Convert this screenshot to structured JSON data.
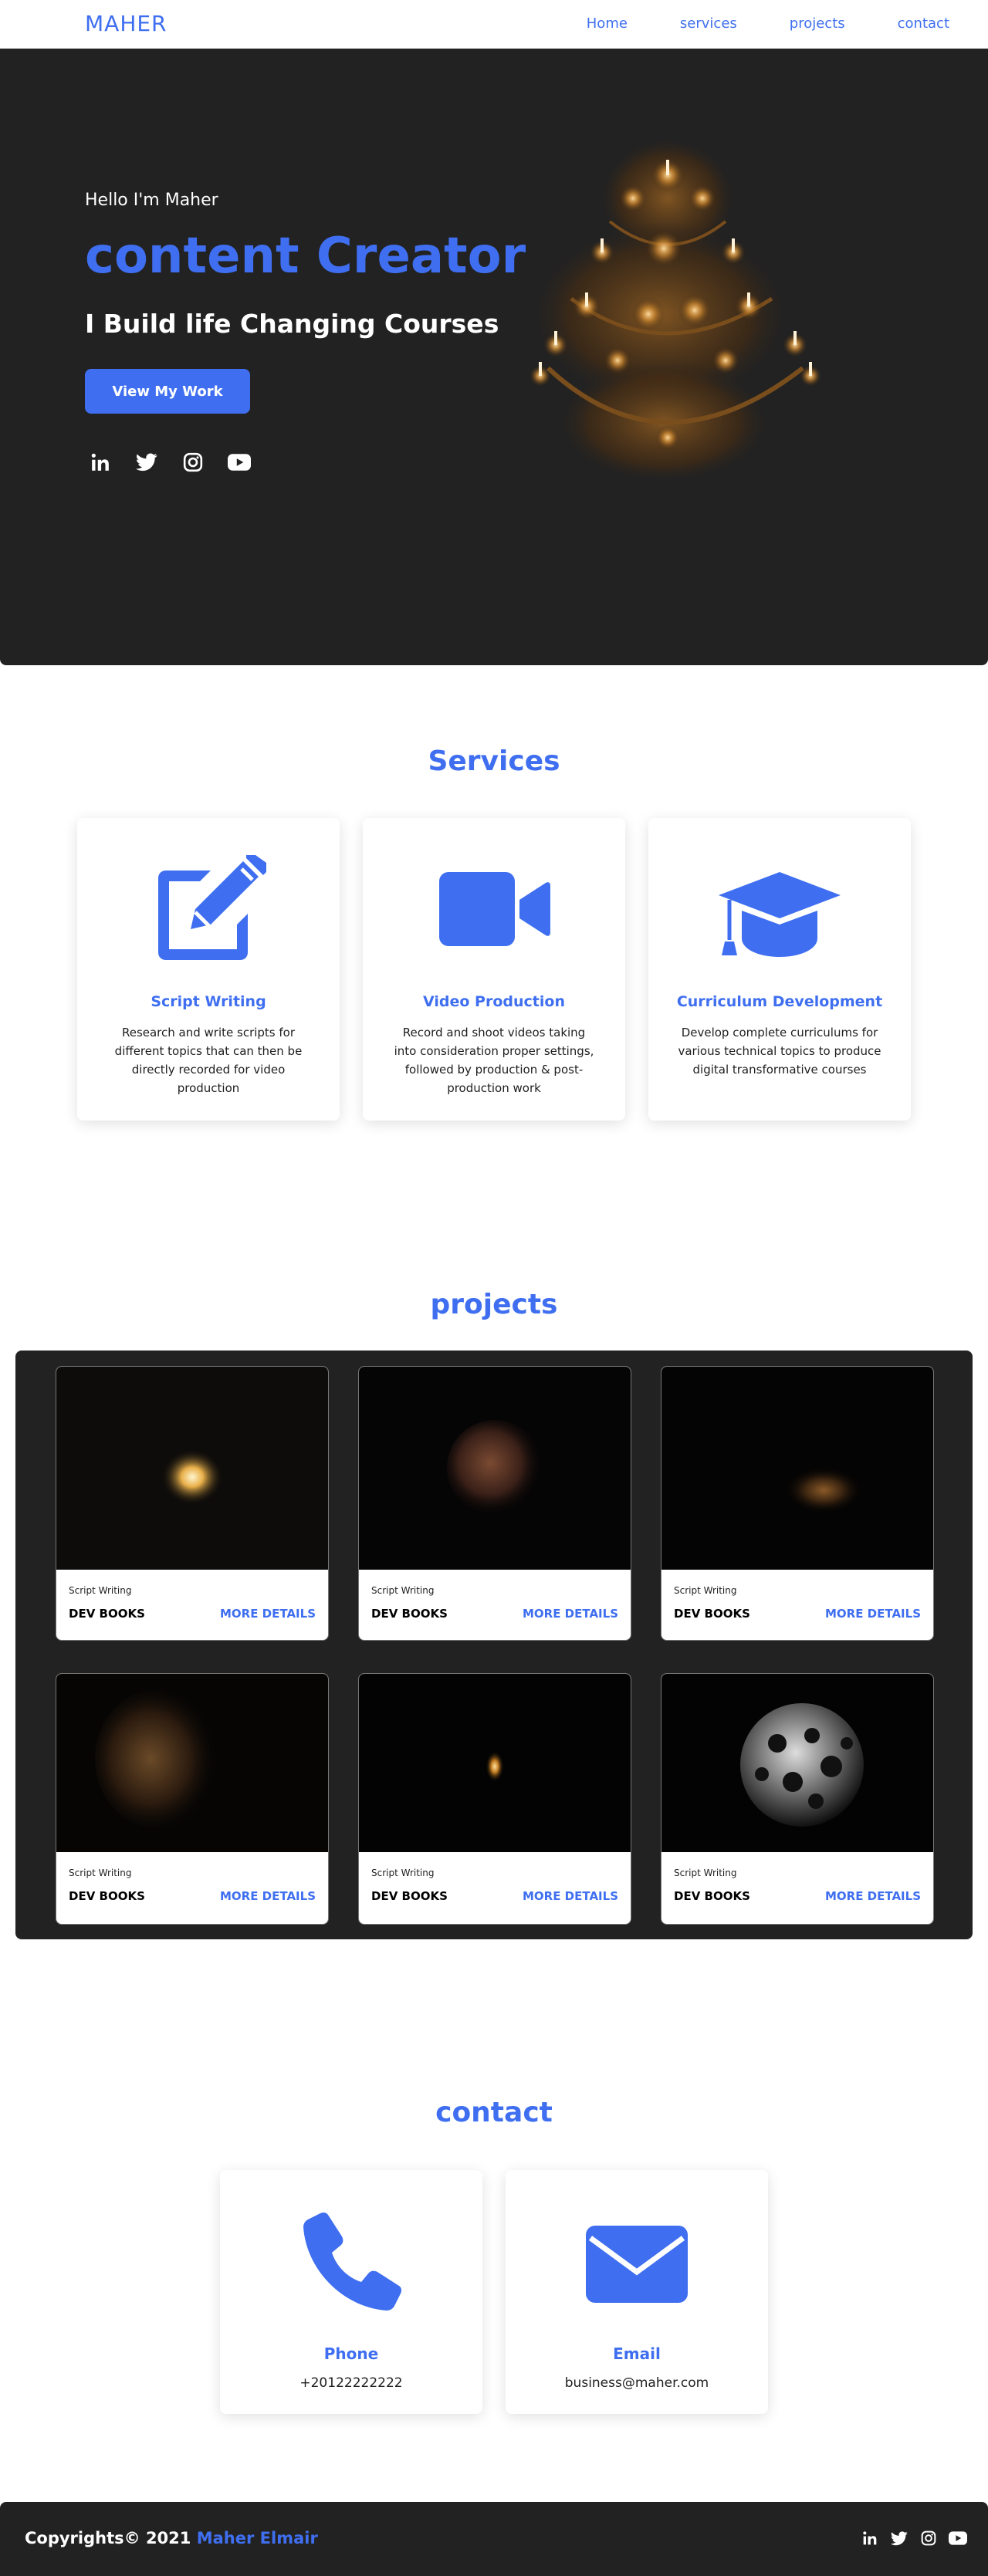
{
  "nav": {
    "brand": "MAHER",
    "links": [
      "Home",
      "services",
      "projects",
      "contact"
    ]
  },
  "hero": {
    "greeting": "Hello I'm Maher",
    "title": "content Creator",
    "subtitle": "I Build life Changing Courses",
    "cta": "View My Work",
    "social_icons": [
      "linkedin-icon",
      "twitter-icon",
      "instagram-icon",
      "youtube-icon"
    ]
  },
  "services": {
    "title": "Services",
    "cards": [
      {
        "icon": "edit-icon",
        "title": "Script Writing",
        "desc": "Research and write scripts for different topics that can then be directly recorded for video production"
      },
      {
        "icon": "video-camera-icon",
        "title": "Video Production",
        "desc": "Record and shoot videos taking into consideration proper settings, followed by production & post-production work"
      },
      {
        "icon": "graduation-cap-icon",
        "title": "Curriculum Development",
        "desc": "Develop complete curriculums for various technical topics to produce digital transformative courses"
      }
    ]
  },
  "projects": {
    "title": "projects",
    "items": [
      {
        "category": "Script Writing",
        "name": "DEV BOOKS",
        "link": "MORE DETAILS"
      },
      {
        "category": "Script Writing",
        "name": "DEV BOOKS",
        "link": "MORE DETAILS"
      },
      {
        "category": "Script Writing",
        "name": "DEV BOOKS",
        "link": "MORE DETAILS"
      },
      {
        "category": "Script Writing",
        "name": "DEV BOOKS",
        "link": "MORE DETAILS"
      },
      {
        "category": "Script Writing",
        "name": "DEV BOOKS",
        "link": "MORE DETAILS"
      },
      {
        "category": "Script Writing",
        "name": "DEV BOOKS",
        "link": "MORE DETAILS"
      }
    ]
  },
  "contact": {
    "title": "contact",
    "cards": [
      {
        "icon": "phone-icon",
        "title": "Phone",
        "value": "+20122222222"
      },
      {
        "icon": "envelope-icon",
        "title": "Email",
        "value": "business@maher.com"
      }
    ]
  },
  "footer": {
    "copyright": "Copyrights© 2021",
    "author": "Maher Elmair",
    "social_icons": [
      "linkedin-icon",
      "twitter-icon",
      "instagram-icon",
      "youtube-icon"
    ]
  },
  "colors": {
    "accent": "#3f6ff0",
    "dark": "#222222",
    "text": "#1e1e1e"
  }
}
